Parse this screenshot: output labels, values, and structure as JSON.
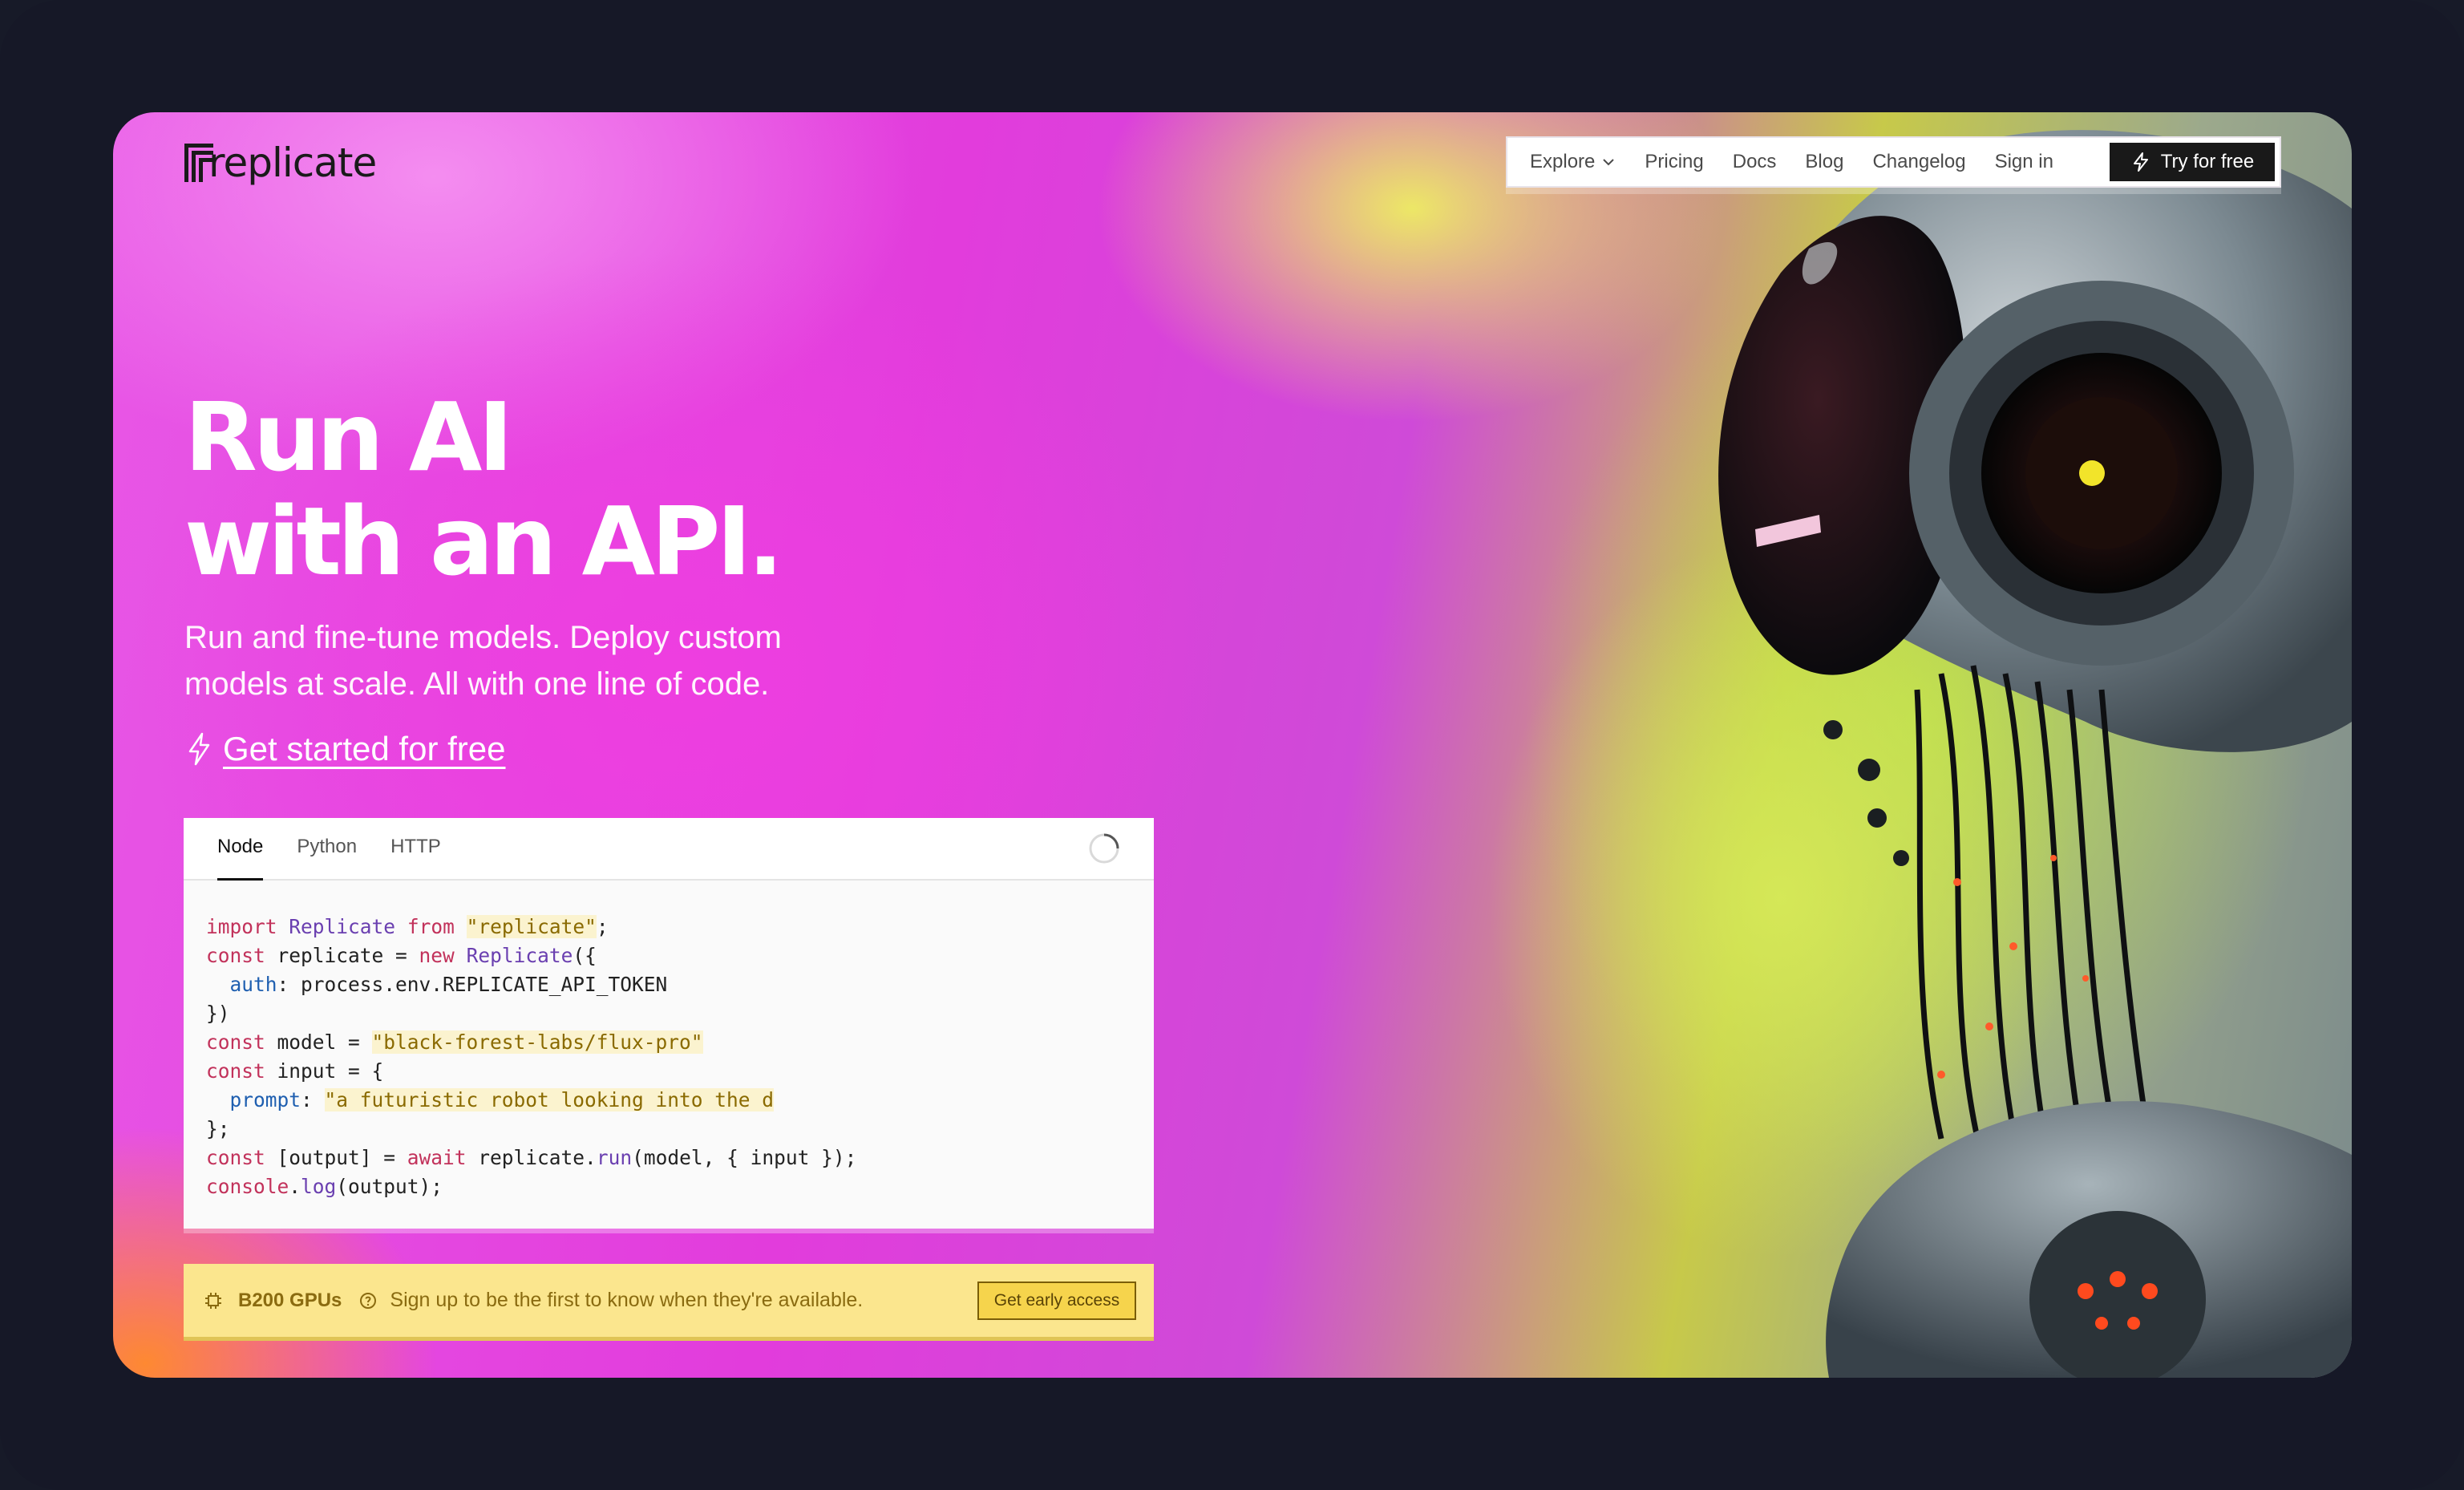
{
  "brand": {
    "name": "replicate"
  },
  "nav": {
    "items": [
      {
        "label": "Explore",
        "dropdown": true
      },
      {
        "label": "Pricing"
      },
      {
        "label": "Docs"
      },
      {
        "label": "Blog"
      },
      {
        "label": "Changelog"
      },
      {
        "label": "Sign in"
      }
    ],
    "cta": "Try for free"
  },
  "hero": {
    "title_line1": "Run AI",
    "title_line2": "with an API.",
    "subtitle_line1": "Run and fine-tune models. Deploy custom",
    "subtitle_line2": "models at scale. All with one line of code.",
    "cta": "Get started for free"
  },
  "code_panel": {
    "tabs": [
      "Node",
      "Python",
      "HTTP"
    ],
    "active_tab": "Node",
    "lines": [
      "import Replicate from \"replicate\";",
      "const replicate = new Replicate({",
      "  auth: process.env.REPLICATE_API_TOKEN",
      "})",
      "const model = \"black-forest-labs/flux-pro\"",
      "const input = {",
      "  prompt: \"a futuristic robot looking into the d",
      "};",
      "const [output] = await replicate.run(model, { input });",
      "console.log(output);"
    ]
  },
  "banner": {
    "title": "B200 GPUs",
    "text": "Sign up to be the first to know when they're available.",
    "button": "Get early access"
  },
  "colors": {
    "frame": "#161827",
    "magenta": "#e23cdc",
    "lime": "#d6e958",
    "banner": "#fbe68e",
    "nav_cta": "#191919"
  }
}
